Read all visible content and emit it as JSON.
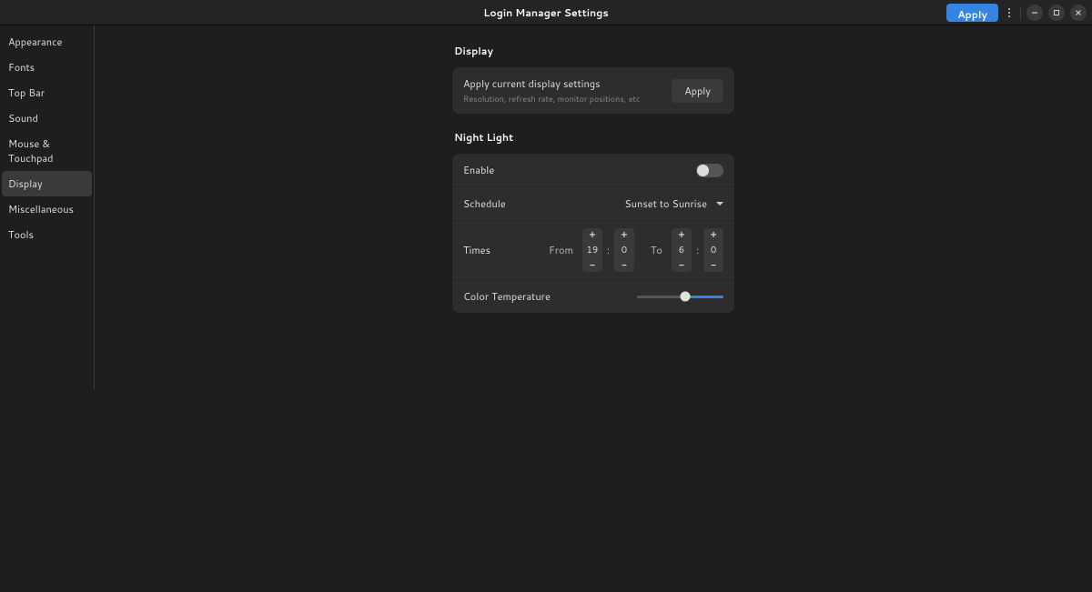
{
  "titlebar": {
    "title": "Login Manager Settings",
    "apply": "Apply"
  },
  "sidebar": {
    "items": [
      {
        "id": "appearance",
        "label": "Appearance"
      },
      {
        "id": "fonts",
        "label": "Fonts"
      },
      {
        "id": "topbar",
        "label": "Top Bar"
      },
      {
        "id": "sound",
        "label": "Sound"
      },
      {
        "id": "mouse",
        "label": "Mouse & Touchpad"
      },
      {
        "id": "display",
        "label": "Display"
      },
      {
        "id": "misc",
        "label": "Miscellaneous"
      },
      {
        "id": "tools",
        "label": "Tools"
      }
    ],
    "active": "display"
  },
  "display": {
    "section_title": "Display",
    "apply_row_title": "Apply current display settings",
    "apply_row_subtitle": "Resolution, refresh rate, monitor positions, etc",
    "apply_row_button": "Apply"
  },
  "nightlight": {
    "section_title": "Night Light",
    "enable_label": "Enable",
    "enable_value": false,
    "schedule_label": "Schedule",
    "schedule_value": "Sunset to Sunrise",
    "times_label": "Times",
    "from_label": "From",
    "to_label": "To",
    "from_hour": "19",
    "from_min": "0",
    "to_hour": "6",
    "to_min": "0",
    "color_temp_label": "Color Temperature",
    "color_temp_percent": 56
  }
}
